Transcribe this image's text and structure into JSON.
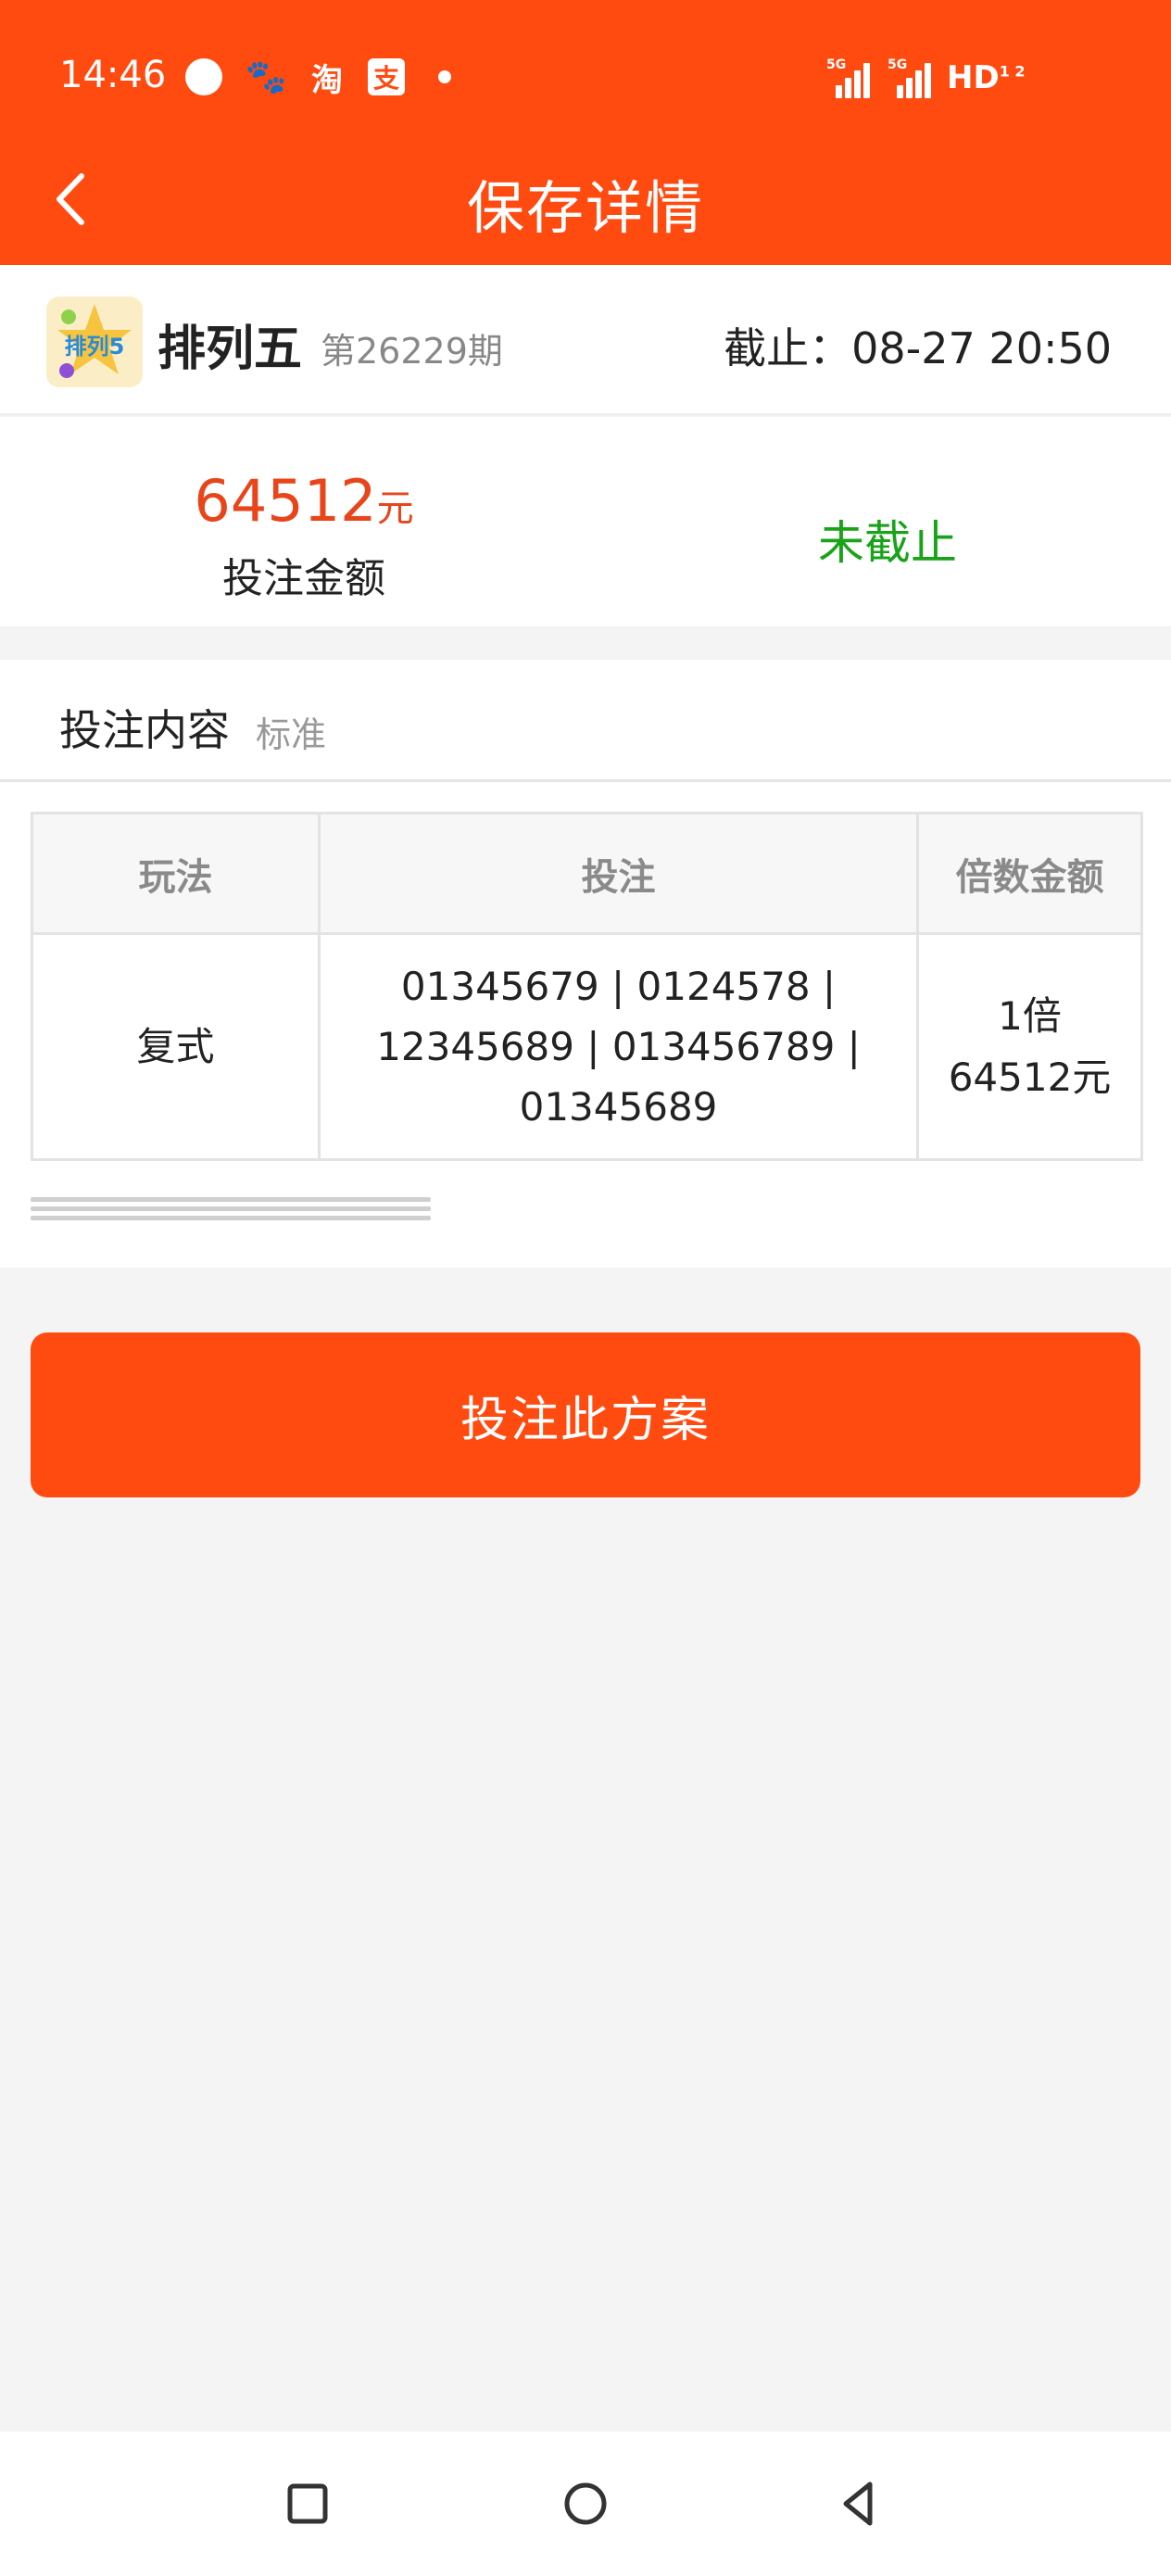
{
  "status_bar": {
    "time": "14:46",
    "notification_icons": [
      "message-bubble-icon",
      "baidu-paw-icon",
      "taobao-icon",
      "alipay-icon",
      "more-dot-icon"
    ],
    "tao_glyph": "淘",
    "pay_glyph": "支",
    "signal_1_label": "5G",
    "signal_2_label": "5G",
    "hd_label": "HD",
    "hd_sup": "1 2"
  },
  "nav": {
    "title": "保存详情",
    "back_icon": "chevron-left-icon"
  },
  "lottery": {
    "name": "排列五",
    "issue": "第26229期",
    "deadline_label": "截止：",
    "deadline_time": "08-27 20:50",
    "logo_icon": "pailie5-logo-icon",
    "logo_text": "排列5"
  },
  "summary": {
    "amount": "64512",
    "amount_unit": "元",
    "amount_label": "投注金额",
    "status": "未截止"
  },
  "content": {
    "title": "投注内容",
    "type": "标准"
  },
  "table": {
    "headers": [
      "玩法",
      "投注",
      "倍数金额"
    ],
    "rows": [
      {
        "play": "复式",
        "bet": "01345679 | 0124578 | 12345689 | 013456789 | 01345689",
        "multiple": "1倍",
        "money": "64512元"
      }
    ]
  },
  "action": {
    "button_label": "投注此方案"
  },
  "colors": {
    "brand": "#ff4a10",
    "amount": "#e8461a",
    "status": "#18a318"
  },
  "system_nav": [
    "recents-square-icon",
    "home-circle-icon",
    "back-triangle-icon"
  ]
}
